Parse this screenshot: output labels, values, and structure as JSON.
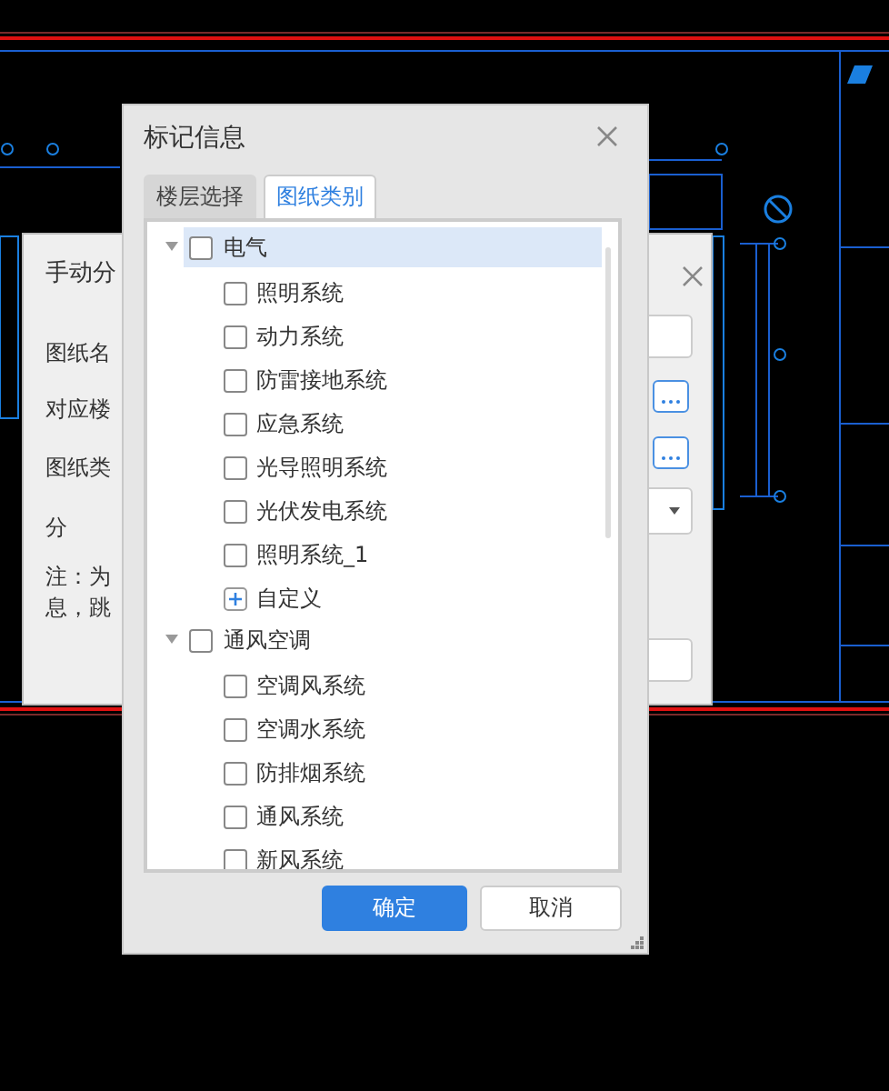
{
  "back_dialog": {
    "title": "手动分",
    "labels": [
      "图纸名",
      "对应楼",
      "图纸类",
      "分"
    ],
    "note_lines": [
      "注：为",
      "息，跳"
    ]
  },
  "dialog": {
    "title": "标记信息",
    "tabs": [
      {
        "label": "楼层选择",
        "selected": false
      },
      {
        "label": "图纸类别",
        "selected": true
      }
    ],
    "tree": [
      {
        "label": "电气",
        "expanded": true,
        "checked": false,
        "selected": true,
        "children": [
          {
            "kind": "checkbox",
            "label": "照明系统",
            "checked": false
          },
          {
            "kind": "checkbox",
            "label": "动力系统",
            "checked": false
          },
          {
            "kind": "checkbox",
            "label": "防雷接地系统",
            "checked": false
          },
          {
            "kind": "checkbox",
            "label": "应急系统",
            "checked": false
          },
          {
            "kind": "checkbox",
            "label": "光导照明系统",
            "checked": false
          },
          {
            "kind": "checkbox",
            "label": "光伏发电系统",
            "checked": false
          },
          {
            "kind": "checkbox",
            "label": "照明系统_1",
            "checked": false
          },
          {
            "kind": "add",
            "label": "自定义"
          }
        ]
      },
      {
        "label": "通风空调",
        "expanded": true,
        "checked": false,
        "selected": false,
        "children": [
          {
            "kind": "checkbox",
            "label": "空调风系统",
            "checked": false
          },
          {
            "kind": "checkbox",
            "label": "空调水系统",
            "checked": false
          },
          {
            "kind": "checkbox",
            "label": "防排烟系统",
            "checked": false
          },
          {
            "kind": "checkbox",
            "label": "通风系统",
            "checked": false
          },
          {
            "kind": "checkbox",
            "label": "新风系统",
            "checked": false
          }
        ]
      }
    ],
    "buttons": [
      {
        "label": "确定",
        "kind": "primary"
      },
      {
        "label": "取消",
        "kind": "secondary"
      }
    ]
  }
}
